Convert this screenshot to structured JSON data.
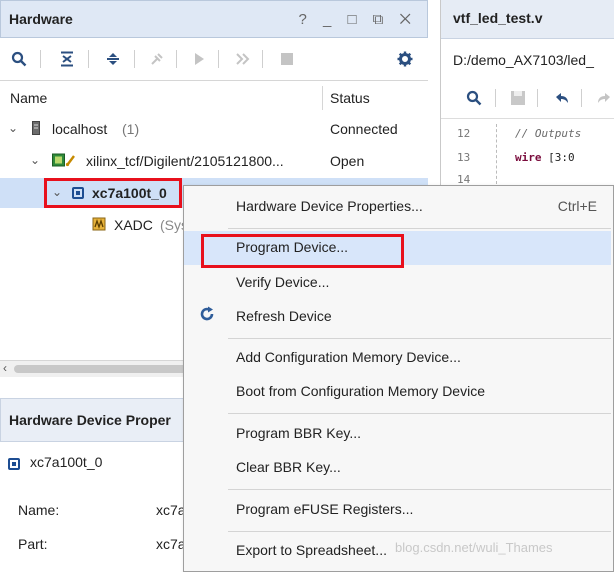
{
  "hardware_panel": {
    "title": "Hardware",
    "window_controls": "? _ □ ⧉ ✕",
    "columns": {
      "name": "Name",
      "status": "Status"
    },
    "rows": [
      {
        "label": "localhost",
        "count": "(1)",
        "status": "Connected"
      },
      {
        "label": "xilinx_tcf/Digilent/2105121800...",
        "status": "Open"
      },
      {
        "label": "xc7a100t_0",
        "status": ""
      },
      {
        "label": "XADC",
        "extra": "(Sys",
        "status": ""
      }
    ]
  },
  "device_properties": {
    "title": "Hardware Device Proper",
    "device": "xc7a100t_0",
    "fields": [
      {
        "label": "Name:",
        "value": "xc7a"
      },
      {
        "label": "Part:",
        "value": "xc7a"
      }
    ]
  },
  "editor": {
    "tab_title": "vtf_led_test.v",
    "path": "D:/demo_AX7103/led_",
    "lines": [
      {
        "num": "12",
        "comment": "// Outputs"
      },
      {
        "num": "13",
        "keyword": "wire",
        "rest": "[3:0"
      },
      {
        "num": "14",
        "rest": ""
      }
    ]
  },
  "context_menu": {
    "items": [
      {
        "label": "Hardware Device Properties...",
        "shortcut": "Ctrl+E"
      },
      {
        "label": "Program Device..."
      },
      {
        "label": "Verify Device..."
      },
      {
        "label": "Refresh Device",
        "icon": "refresh-icon"
      },
      {
        "label": "Add Configuration Memory Device..."
      },
      {
        "label": "Boot from Configuration Memory Device"
      },
      {
        "label": "Program BBR Key..."
      },
      {
        "label": "Clear BBR Key..."
      },
      {
        "label": "Program eFUSE Registers..."
      },
      {
        "label": "Export to Spreadsheet..."
      }
    ]
  },
  "watermark": "blog.csdn.net/wuli_Thames",
  "colors": {
    "highlight_box": "#e8101c",
    "selection": "#cfe0f7",
    "menu_hover": "#d8e6fa"
  }
}
